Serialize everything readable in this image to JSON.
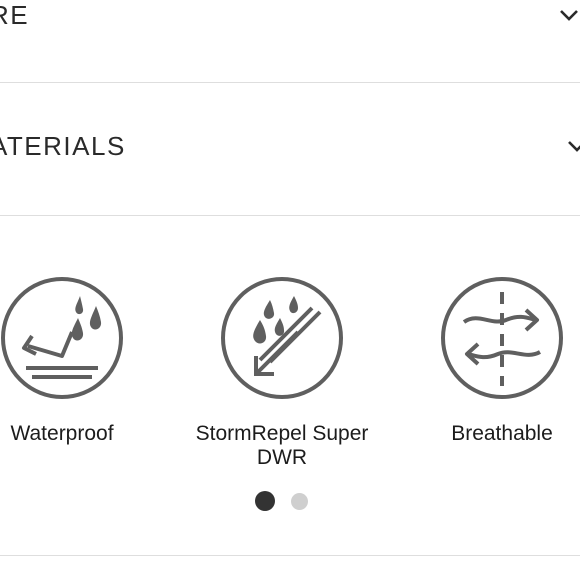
{
  "accordion": [
    {
      "title": "RE",
      "icon": "chevron-down-icon"
    },
    {
      "title": "ATERIALS",
      "icon": "chevron-down-icon"
    }
  ],
  "features": [
    {
      "label": "Waterproof",
      "icon": "waterproof-icon"
    },
    {
      "label": "StormRepel Super DWR",
      "icon": "stormrepel-dwr-icon"
    },
    {
      "label": "Breathable",
      "icon": "breathable-icon"
    }
  ],
  "carousel": {
    "pages": 2,
    "current": 1
  },
  "colors": {
    "icon_stroke": "#5f5f5f",
    "dot_active": "#333333",
    "dot_inactive": "#cfcfcf",
    "divider": "#dedede"
  }
}
